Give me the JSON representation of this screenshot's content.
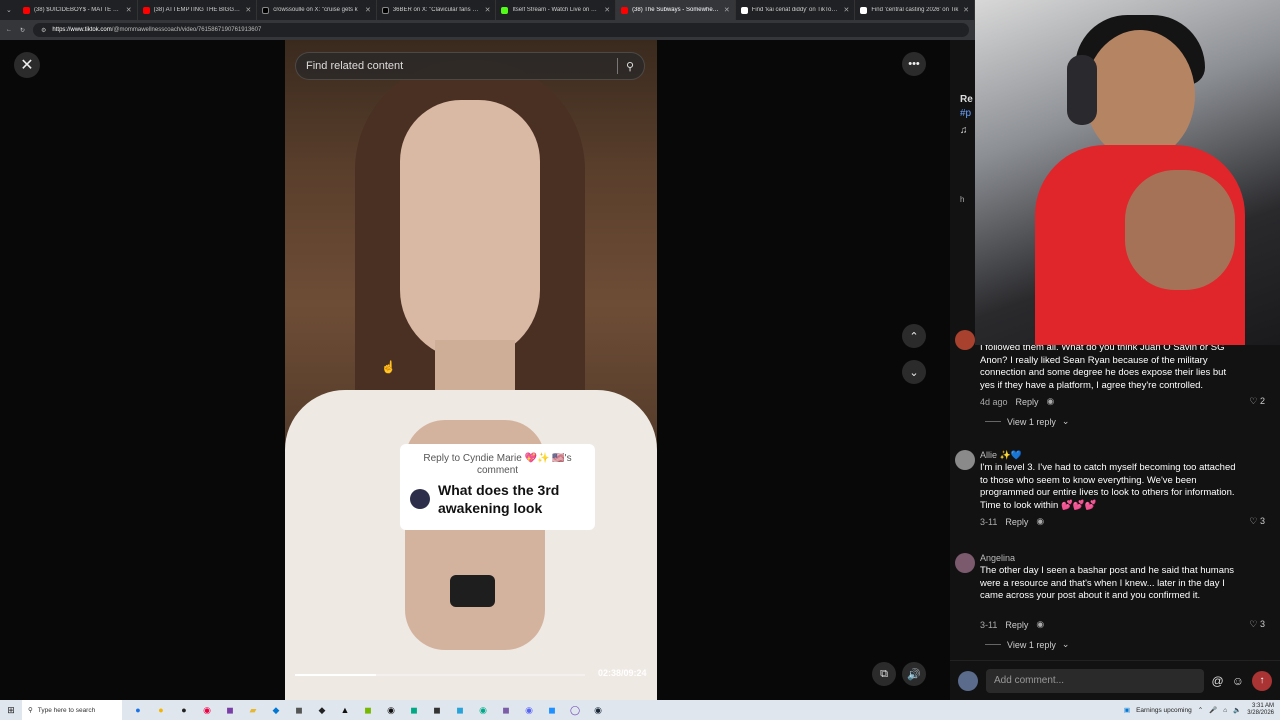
{
  "tabs": [
    {
      "title": "(38) $UICIDEBOY$ - MATTE BLACK",
      "color": "#ff0000",
      "active": false
    },
    {
      "title": "(38) ATTEMPTING THE BIGGEST E",
      "color": "#ff0000",
      "active": false
    },
    {
      "title": "crowssoulle on X: \"cruise gets k",
      "color": "#000000",
      "active": false
    },
    {
      "title": "36BER on X: \"Clavicular fans are h",
      "color": "#000000",
      "active": false
    },
    {
      "title": "Itself Stream - Watch Live on Kick",
      "color": "#53fc18",
      "active": false
    },
    {
      "title": "(38) The Subways - Somewhere (C",
      "color": "#ff0000",
      "active": true
    },
    {
      "title": "Find 'kai cenat diddy' on TikTok | T",
      "color": "#ffffff",
      "active": false
    },
    {
      "title": "Find 'central casting 2026' on Tik",
      "color": "#ffffff",
      "active": false
    }
  ],
  "address": {
    "domain": "https://www.tiktok.com",
    "path": "/@mommawellnesscoach/video/7615867190761913607"
  },
  "search": {
    "placeholder": "Find related content"
  },
  "video": {
    "reply_to": "Reply to Cyndie Marie 💖✨ 🇺🇸's comment",
    "question": "What does the 3rd awakening look",
    "timecode": "02:38/09:24",
    "progress": 0.28
  },
  "side_peek": {
    "line1": "Re",
    "line2": "#p",
    "line3": "♫",
    "line4": "h"
  },
  "comments": [
    {
      "name": "",
      "text": "I followed them all. What do you think Juan O Savin or SG Anon? I really liked Sean Ryan because of the military connection and some degree he does expose their lies but yes if they have a platform, I agree they're controlled.",
      "date": "4d ago",
      "reply": "Reply",
      "likes": "2",
      "view_replies": "View 1 reply",
      "avatar_color": "#a8412e"
    },
    {
      "name": "Allie ✨💙",
      "text": "I'm in level 3. I've had to catch myself becoming too attached to those who seem to know everything. We've been programmed our entire lives to look to others for information. Time to look within 💕💕💕",
      "date": "3-11",
      "reply": "Reply",
      "likes": "3",
      "avatar_color": "#8a8a8a"
    },
    {
      "name": "Angelina",
      "text": "The other day I seen a bashar post and he said that humans were a resource and that's when I knew... later in the day I came across your post about it and you confirmed it.",
      "date": "3-11",
      "reply": "Reply",
      "likes": "3",
      "view_replies": "View 1 reply",
      "avatar_color": "#7b5a6e"
    }
  ],
  "comment_input": {
    "placeholder": "Add comment..."
  },
  "taskbar": {
    "search_placeholder": "Type here to search",
    "weather": "Earnings upcoming",
    "time": "3:31 AM",
    "date": "3/28/2026"
  }
}
